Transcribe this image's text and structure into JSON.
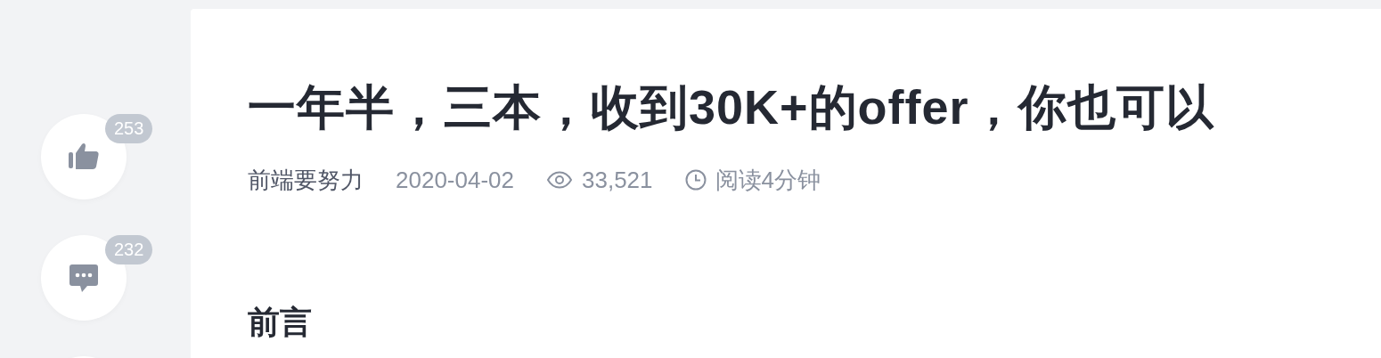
{
  "side_buttons": [
    {
      "kind": "like",
      "count": "253"
    },
    {
      "kind": "comment",
      "count": "232"
    },
    {
      "kind": "other"
    }
  ],
  "article": {
    "title": "一年半，三本，收到30K+的offer，你也可以",
    "author": "前端要努力",
    "date": "2020-04-02",
    "views": "33,521",
    "read_time": "阅读4分钟",
    "heading": "前言"
  }
}
